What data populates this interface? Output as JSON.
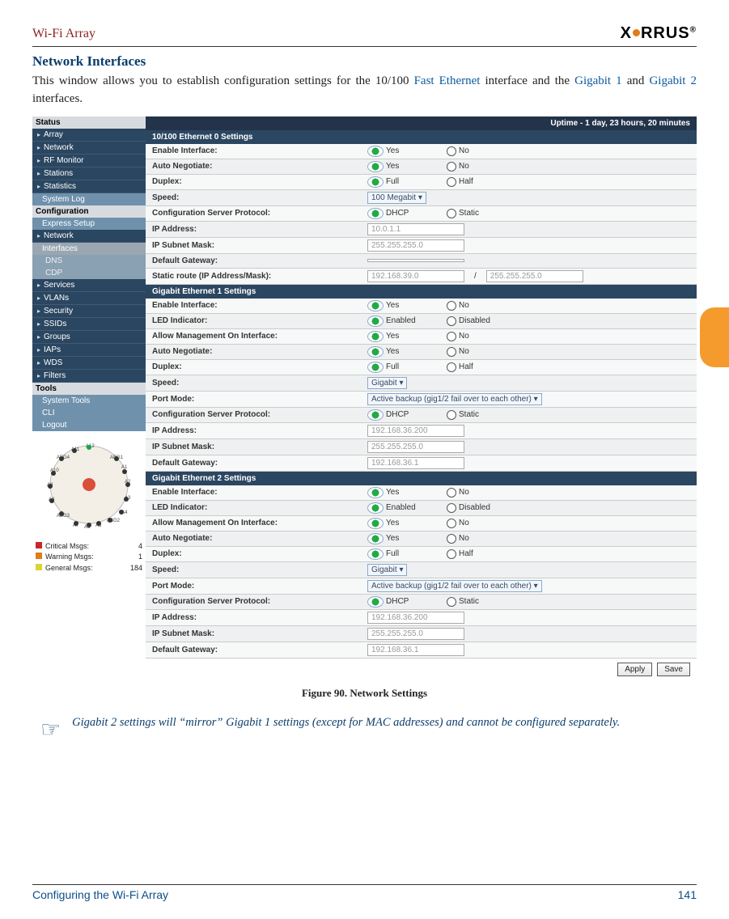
{
  "header": {
    "title": "Wi-Fi Array",
    "logo_text": "X   RRUS",
    "logo_reg": "®"
  },
  "section_title": "Network Interfaces",
  "intro": {
    "t1": "This window allows you to establish configuration settings for the 10/100 ",
    "l1": "Fast Ethernet",
    "t2": " interface and the ",
    "l2": "Gigabit 1",
    "t3": " and ",
    "l3": "Gigabit 2",
    "t4": " interfaces."
  },
  "tab_pos": "",
  "footer": {
    "left": "Configuring the Wi-Fi Array",
    "right": "141"
  },
  "figure_caption": "Figure 90. Network Settings",
  "note": "Gigabit 2 settings will “mirror” Gigabit 1 settings (except for MAC addresses) and cannot be configured separately.",
  "ui": {
    "uptime": "Uptime - 1 day, 23 hours, 20 minutes",
    "sidebar": {
      "status_hdr": "Status",
      "items_status": [
        "Array",
        "Network",
        "RF Monitor",
        "Stations",
        "Statistics"
      ],
      "status_sub": "System Log",
      "config_hdr": "Configuration",
      "config_items": [
        "Express Setup",
        "Network"
      ],
      "net_subs": [
        "Interfaces",
        "DNS",
        "CDP"
      ],
      "more_items": [
        "Services",
        "VLANs",
        "Security",
        "SSIDs",
        "Groups",
        "IAPs",
        "WDS",
        "Filters"
      ],
      "tools_hdr": "Tools",
      "tools_items": [
        "System Tools",
        "CLI",
        "Logout"
      ],
      "mgs": {
        "crit": {
          "label": "Critical Msgs:",
          "count": "4",
          "color": "#c62828"
        },
        "warn": {
          "label": "Warning Msgs:",
          "count": "1",
          "color": "#e07d1a"
        },
        "gen": {
          "label": "General Msgs:",
          "count": "184",
          "color": "#d9d531"
        }
      },
      "radar_labels": [
        "A12",
        "A11",
        "ABG4",
        "ABG1",
        "A10",
        "A1",
        "A2",
        "A9",
        "A3",
        "A8",
        "A4",
        "ABG3",
        "ABG2",
        "A7",
        "A6",
        "A5"
      ]
    },
    "sections": [
      {
        "title": "10/100 Ethernet 0 Settings",
        "rows": [
          {
            "label": "Enable Interface:",
            "type": "yn",
            "sel": "Yes",
            "o1": "Yes",
            "o2": "No"
          },
          {
            "label": "Auto Negotiate:",
            "type": "yn",
            "sel": "Yes",
            "o1": "Yes",
            "o2": "No"
          },
          {
            "label": "Duplex:",
            "type": "yn",
            "sel": "Full",
            "o1": "Full",
            "o2": "Half"
          },
          {
            "label": "Speed:",
            "type": "sel",
            "val": "100 Megabit"
          },
          {
            "label": "Configuration Server Protocol:",
            "type": "yn",
            "sel": "DHCP",
            "o1": "DHCP",
            "o2": "Static"
          },
          {
            "label": "IP Address:",
            "type": "txt",
            "val": "10.0.1.1"
          },
          {
            "label": "IP Subnet Mask:",
            "type": "txt",
            "val": "255.255.255.0"
          },
          {
            "label": "Default Gateway:",
            "type": "txt",
            "val": ""
          },
          {
            "label": "Static route (IP Address/Mask):",
            "type": "route",
            "v1": "192.168.39.0",
            "v2": "255.255.255.0"
          }
        ]
      },
      {
        "title": "Gigabit Ethernet 1 Settings",
        "rows": [
          {
            "label": "Enable Interface:",
            "type": "yn",
            "sel": "Yes",
            "o1": "Yes",
            "o2": "No"
          },
          {
            "label": "LED Indicator:",
            "type": "yn",
            "sel": "Enabled",
            "o1": "Enabled",
            "o2": "Disabled"
          },
          {
            "label": "Allow Management On Interface:",
            "type": "yn",
            "sel": "Yes",
            "o1": "Yes",
            "o2": "No"
          },
          {
            "label": "Auto Negotiate:",
            "type": "yn",
            "sel": "Yes",
            "o1": "Yes",
            "o2": "No"
          },
          {
            "label": "Duplex:",
            "type": "yn",
            "sel": "Full",
            "o1": "Full",
            "o2": "Half"
          },
          {
            "label": "Speed:",
            "type": "sel",
            "val": "Gigabit"
          },
          {
            "label": "Port Mode:",
            "type": "sel",
            "val": "Active backup (gig1/2 fail over to each other)"
          },
          {
            "label": "Configuration Server Protocol:",
            "type": "yn",
            "sel": "DHCP",
            "o1": "DHCP",
            "o2": "Static"
          },
          {
            "label": "IP Address:",
            "type": "txt",
            "val": "192.168.36.200"
          },
          {
            "label": "IP Subnet Mask:",
            "type": "txt",
            "val": "255.255.255.0"
          },
          {
            "label": "Default Gateway:",
            "type": "txt",
            "val": "192.168.36.1"
          }
        ]
      },
      {
        "title": "Gigabit Ethernet 2 Settings",
        "rows": [
          {
            "label": "Enable Interface:",
            "type": "yn",
            "sel": "Yes",
            "o1": "Yes",
            "o2": "No"
          },
          {
            "label": "LED Indicator:",
            "type": "yn",
            "sel": "Enabled",
            "o1": "Enabled",
            "o2": "Disabled"
          },
          {
            "label": "Allow Management On Interface:",
            "type": "yn",
            "sel": "Yes",
            "o1": "Yes",
            "o2": "No"
          },
          {
            "label": "Auto Negotiate:",
            "type": "yn",
            "sel": "Yes",
            "o1": "Yes",
            "o2": "No"
          },
          {
            "label": "Duplex:",
            "type": "yn",
            "sel": "Full",
            "o1": "Full",
            "o2": "Half"
          },
          {
            "label": "Speed:",
            "type": "sel",
            "val": "Gigabit"
          },
          {
            "label": "Port Mode:",
            "type": "sel",
            "val": "Active backup (gig1/2 fail over to each other)"
          },
          {
            "label": "Configuration Server Protocol:",
            "type": "yn",
            "sel": "DHCP",
            "o1": "DHCP",
            "o2": "Static"
          },
          {
            "label": "IP Address:",
            "type": "txt",
            "val": "192.168.36.200"
          },
          {
            "label": "IP Subnet Mask:",
            "type": "txt",
            "val": "255.255.255.0"
          },
          {
            "label": "Default Gateway:",
            "type": "txt",
            "val": "192.168.36.1"
          }
        ]
      }
    ],
    "buttons": {
      "apply": "Apply",
      "save": "Save"
    }
  }
}
